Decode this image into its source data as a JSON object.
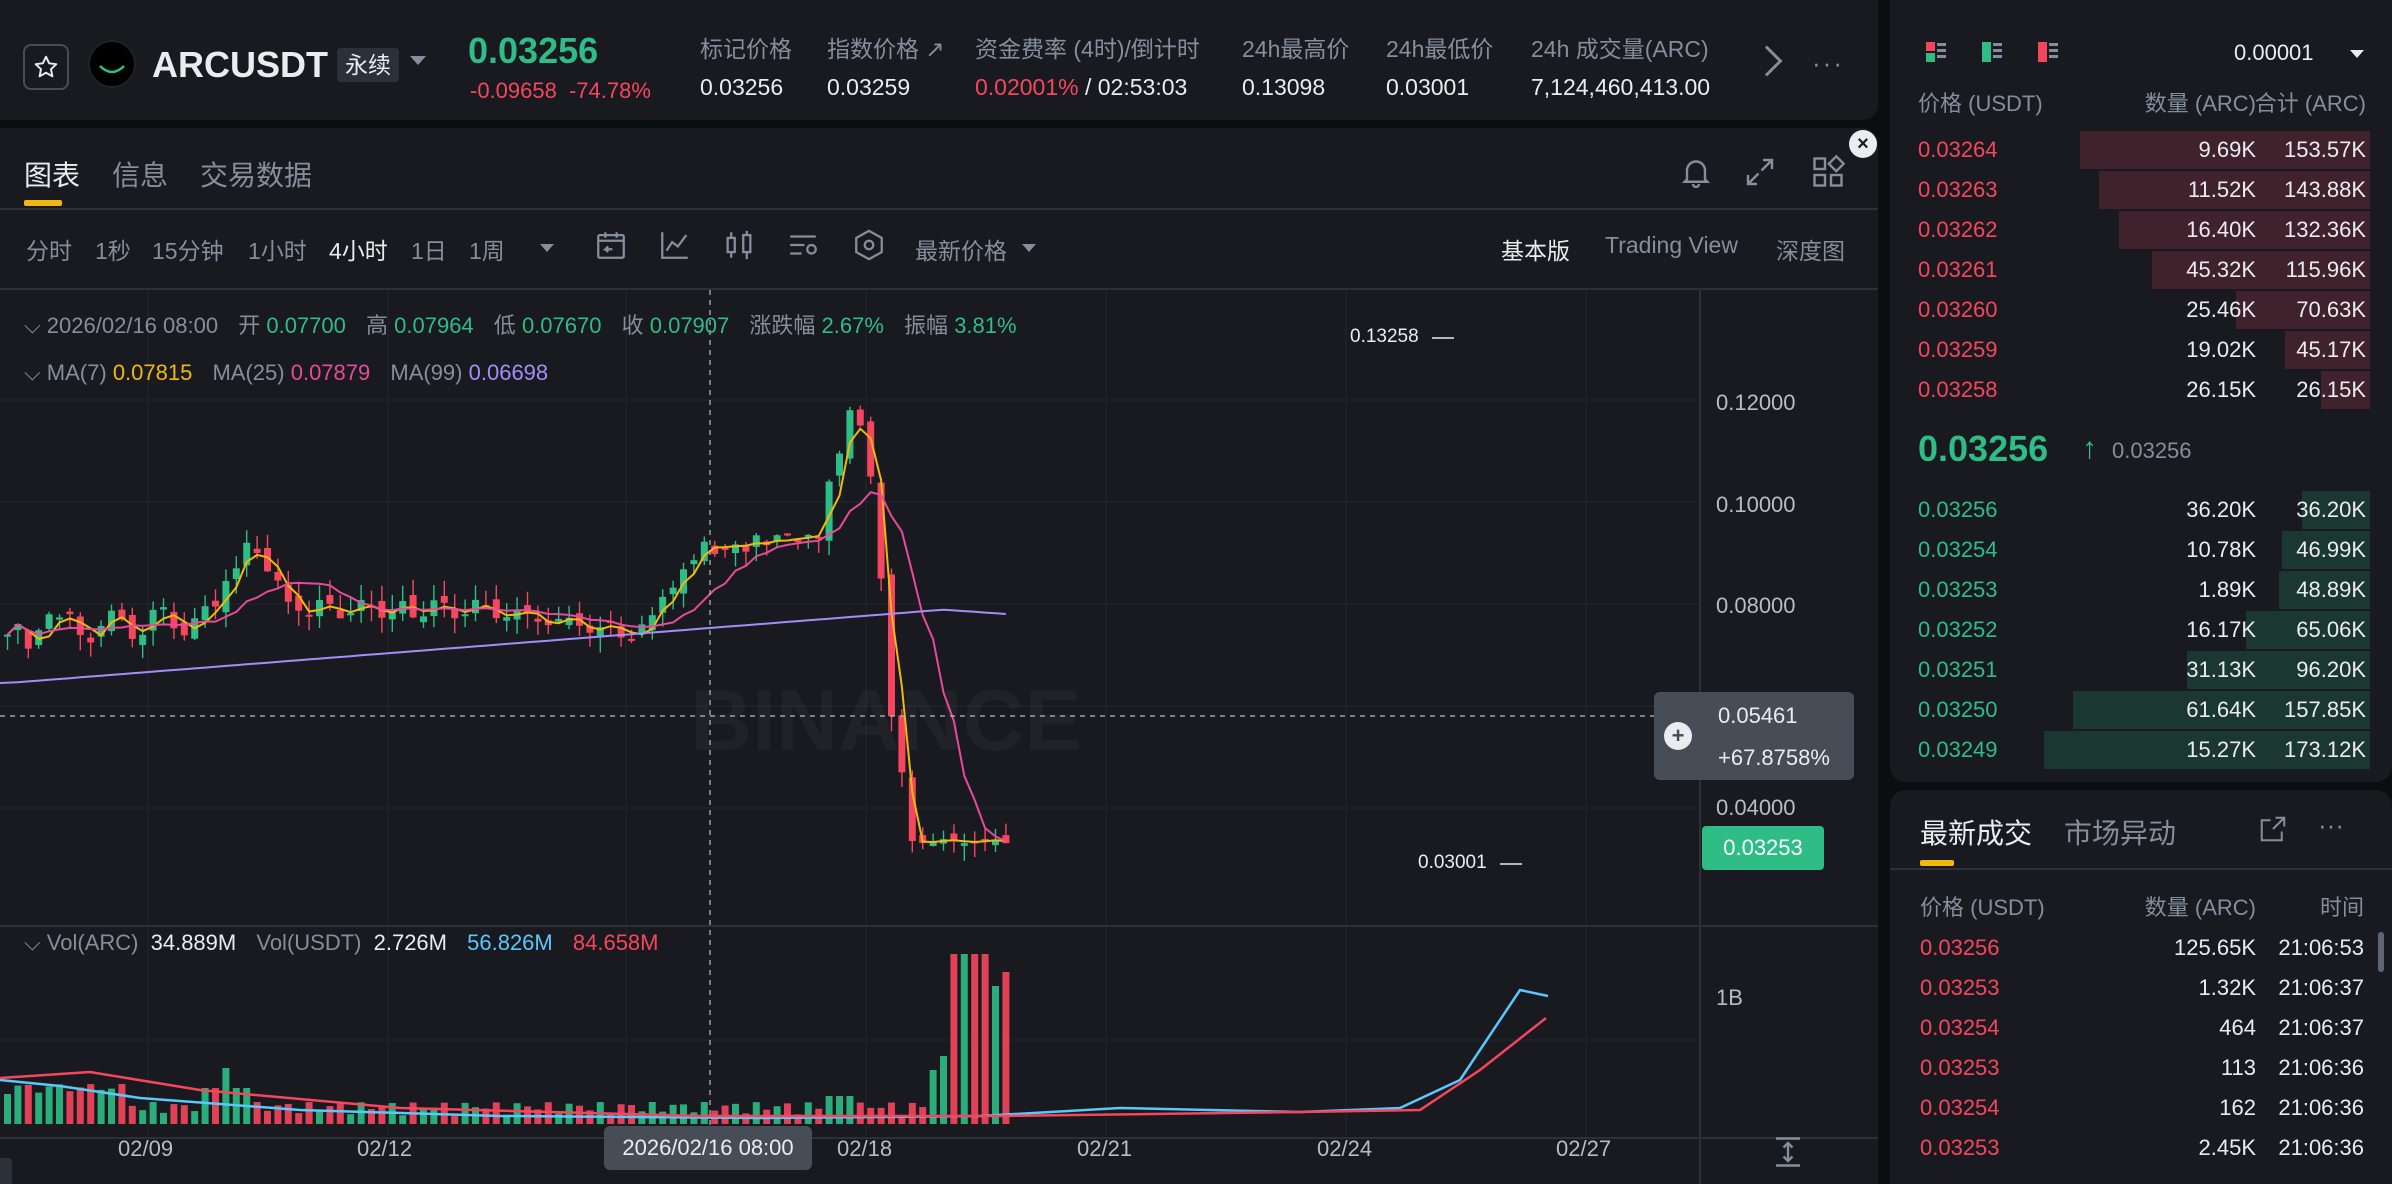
{
  "ticker": {
    "symbol": "ARCUSDT",
    "badge": "永续",
    "last_price": "0.03256",
    "change_abs": "-0.09658",
    "change_pct": "-74.78%",
    "stats": [
      {
        "label": "标记价格",
        "value": "0.03256"
      },
      {
        "label": "指数价格 ↗",
        "value": "0.03259"
      },
      {
        "label": "资金费率 (4时)/倒计时",
        "value_rate": "0.02001%",
        "value_sep": " / ",
        "value_time": "02:53:03"
      },
      {
        "label": "24h最高价",
        "value": "0.13098"
      },
      {
        "label": "24h最低价",
        "value": "0.03001"
      },
      {
        "label": "24h 成交量(ARC)",
        "value": "7,124,460,413.00"
      }
    ]
  },
  "panel_tabs": [
    "图表",
    "信息",
    "交易数据"
  ],
  "intervals": [
    "分时",
    "1秒",
    "15分钟",
    "1小时",
    "4小时",
    "1日",
    "1周"
  ],
  "active_interval": "4小时",
  "price_type": "最新价格",
  "views": [
    "基本版",
    "Trading View",
    "深度图"
  ],
  "ohlc": {
    "date": "2026/02/16 08:00",
    "open_label": "开",
    "open": "0.07700",
    "high_label": "高",
    "high": "0.07964",
    "low_label": "低",
    "low": "0.07670",
    "close_label": "收",
    "close": "0.07907",
    "chg_label": "涨跌幅",
    "chg": "2.67%",
    "amp_label": "振幅",
    "amp": "3.81%"
  },
  "ma": [
    {
      "label": "MA(7)",
      "value": "0.07815",
      "color": "#f0b90b"
    },
    {
      "label": "MA(25)",
      "value": "0.07879",
      "color": "#e84a9b"
    },
    {
      "label": "MA(99)",
      "value": "0.06698",
      "color": "#a78bfa"
    }
  ],
  "volume": {
    "label_arc": "Vol(ARC)",
    "value_arc": "34.889M",
    "label_usdt": "Vol(USDT)",
    "value_usdt": "2.726M",
    "ma1": "56.826M",
    "ma2": "84.658M",
    "axis_label": "1B"
  },
  "y_axis": [
    "0.12000",
    "0.10000",
    "0.08000",
    "0.04000"
  ],
  "x_axis": [
    "02/09",
    "02/12",
    "02/18",
    "02/21",
    "02/24",
    "02/27"
  ],
  "crosshair": {
    "price": "0.05461",
    "pct": "+67.8758%",
    "date": "2026/02/16 08:00"
  },
  "current_price_tag": "0.03253",
  "high_mark": "0.13258",
  "low_mark": "0.03001",
  "watermark": "BINANCE",
  "orderbook": {
    "tick": "0.00001",
    "headers": [
      "价格 (USDT)",
      "数量 (ARC)",
      "合计 (ARC)"
    ],
    "asks": [
      {
        "price": "0.03264",
        "qty": "9.69K",
        "total": "153.57K",
        "depth": 0.89
      },
      {
        "price": "0.03263",
        "qty": "11.52K",
        "total": "143.88K",
        "depth": 0.83
      },
      {
        "price": "0.03262",
        "qty": "16.40K",
        "total": "132.36K",
        "depth": 0.77
      },
      {
        "price": "0.03261",
        "qty": "45.32K",
        "total": "115.96K",
        "depth": 0.67
      },
      {
        "price": "0.03260",
        "qty": "25.46K",
        "total": "70.63K",
        "depth": 0.41
      },
      {
        "price": "0.03259",
        "qty": "19.02K",
        "total": "45.17K",
        "depth": 0.26
      },
      {
        "price": "0.03258",
        "qty": "26.15K",
        "total": "26.15K",
        "depth": 0.15
      }
    ],
    "mid_price": "0.03256",
    "mid_arrow": "↑",
    "mark_price": "0.03256",
    "bids": [
      {
        "price": "0.03256",
        "qty": "36.20K",
        "total": "36.20K",
        "depth": 0.21
      },
      {
        "price": "0.03254",
        "qty": "10.78K",
        "total": "46.99K",
        "depth": 0.27
      },
      {
        "price": "0.03253",
        "qty": "1.89K",
        "total": "48.89K",
        "depth": 0.28
      },
      {
        "price": "0.03252",
        "qty": "16.17K",
        "total": "65.06K",
        "depth": 0.38
      },
      {
        "price": "0.03251",
        "qty": "31.13K",
        "total": "96.20K",
        "depth": 0.56
      },
      {
        "price": "0.03250",
        "qty": "61.64K",
        "total": "157.85K",
        "depth": 0.91
      },
      {
        "price": "0.03249",
        "qty": "15.27K",
        "total": "173.12K",
        "depth": 1.0
      }
    ]
  },
  "trades": {
    "tabs": [
      "最新成交",
      "市场异动"
    ],
    "headers": [
      "价格 (USDT)",
      "数量 (ARC)",
      "时间"
    ],
    "rows": [
      {
        "price": "0.03256",
        "qty": "125.65K",
        "time": "21:06:53"
      },
      {
        "price": "0.03253",
        "qty": "1.32K",
        "time": "21:06:37"
      },
      {
        "price": "0.03254",
        "qty": "464",
        "time": "21:06:37"
      },
      {
        "price": "0.03253",
        "qty": "113",
        "time": "21:06:36"
      },
      {
        "price": "0.03254",
        "qty": "162",
        "time": "21:06:36"
      },
      {
        "price": "0.03253",
        "qty": "2.45K",
        "time": "21:06:36"
      }
    ]
  },
  "colors": {
    "up": "#2ebd85",
    "down": "#f6465d",
    "accent": "#f0b90b",
    "funding": "#f6465d"
  }
}
